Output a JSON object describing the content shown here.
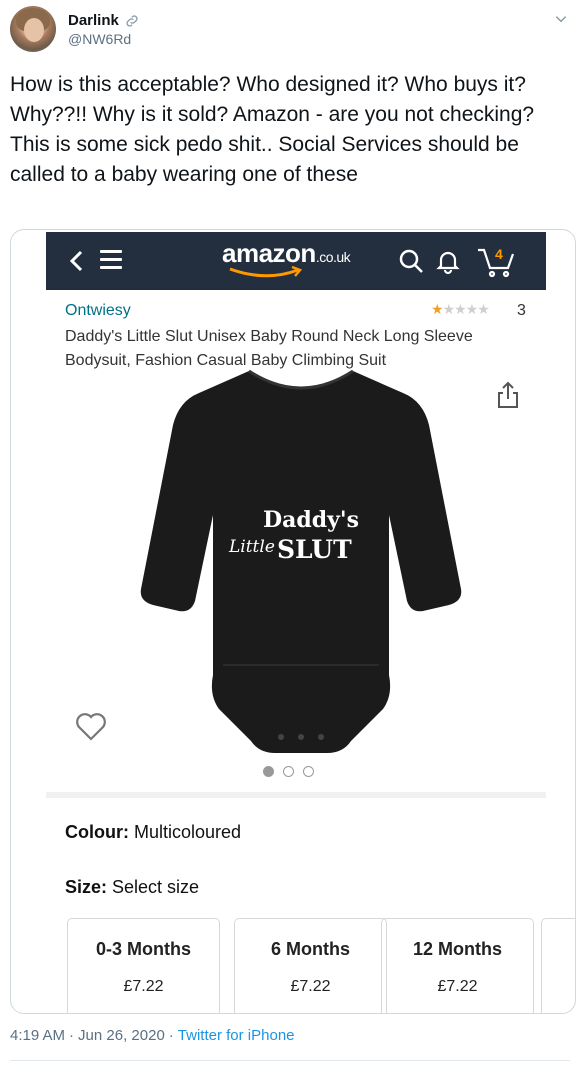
{
  "tweet": {
    "display_name": "Darlink",
    "handle": "@NW6Rd",
    "text": "How is this acceptable? Who designed it? Who buys it? Why??!! Why is it sold? Amazon - are you not checking? This is some sick pedo shit.. Social Services should be called to a baby wearing one of these",
    "time": "4:19 AM",
    "date": "Jun 26, 2020",
    "separator": "·",
    "source": "Twitter for iPhone"
  },
  "amazon": {
    "logo": "amazon",
    "tld": ".co.uk",
    "cart_count": "4",
    "brand": "Ontwiesy",
    "rating_stars": 1,
    "rating_max": 5,
    "rating_count": "3",
    "product_title": "Daddy's Little Slut Unisex Baby Round Neck Long Sleeve Bodysuit, Fashion Casual Baby Climbing Suit",
    "print": {
      "line1": "Daddy's",
      "little": "Little",
      "slut": "SLUT"
    },
    "carousel": {
      "count": 3,
      "active": 0
    },
    "colour_label": "Colour:",
    "colour_value": "Multicoloured",
    "size_label": "Size:",
    "size_value": "Select size",
    "sizes": [
      {
        "label": "0-3 Months",
        "price": "£7.22"
      },
      {
        "label": "6 Months",
        "price": "£7.22"
      },
      {
        "label": "12 Months",
        "price": "£7.22"
      }
    ]
  },
  "colors": {
    "amazon_bar": "#232f3e",
    "amazon_orange": "#ff9900",
    "link_blue": "#007185",
    "twitter_blue": "#1b95e0"
  }
}
